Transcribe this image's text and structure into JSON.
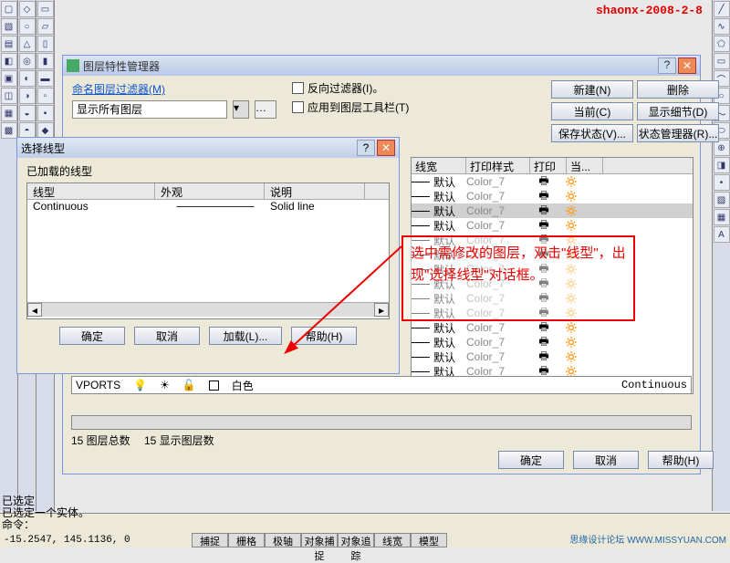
{
  "watermark": "shaonx-2008-2-8",
  "layerDialog": {
    "title": "图层特性管理器",
    "filterLabel": "命名图层过滤器(M)",
    "filterValue": "显示所有图层",
    "cbReverse": "反向过滤器(I)。",
    "cbApply": "应用到图层工具栏(T)",
    "buttons": {
      "new": "新建(N)",
      "delete": "删除",
      "current": "当前(C)",
      "details": "显示细节(D)",
      "saveState": "保存状态(V)...",
      "stateManager": "状态管理器(R)..."
    },
    "columns": {
      "lineweight": "线宽",
      "plotstyle": "打印样式",
      "print": "打印",
      "current": "当..."
    },
    "rows": [
      {
        "lw": "默认",
        "ps": "Color_7",
        "sel": false
      },
      {
        "lw": "默认",
        "ps": "Color_7",
        "sel": false
      },
      {
        "lw": "默认",
        "ps": "Color_7",
        "sel": true
      },
      {
        "lw": "默认",
        "ps": "Color_7",
        "sel": false
      },
      {
        "lw": "默认",
        "ps": "Color_7",
        "sel": false
      },
      {
        "lw": "默认",
        "ps": "Color_7",
        "sel": false
      },
      {
        "lw": "默认",
        "ps": "Color_7",
        "sel": false
      },
      {
        "lw": "默认",
        "ps": "Color_7",
        "sel": false
      },
      {
        "lw": "默认",
        "ps": "Color_7",
        "sel": false
      },
      {
        "lw": "默认",
        "ps": "Color_7",
        "sel": false
      },
      {
        "lw": "默认",
        "ps": "Color_7",
        "sel": false
      },
      {
        "lw": "默认",
        "ps": "Color_7",
        "sel": false
      },
      {
        "lw": "默认",
        "ps": "Color_7",
        "sel": false
      },
      {
        "lw": "默认",
        "ps": "Color_7",
        "sel": false
      }
    ],
    "fullRow": {
      "name": "VPORTS",
      "color": "白色",
      "linetype": "Continuous"
    },
    "status": {
      "total": "15 图层总数",
      "shown": "15 显示图层数"
    },
    "ok": "确定",
    "cancel": "取消",
    "help": "帮助(H)"
  },
  "linetypeDialog": {
    "title": "选择线型",
    "loaded": "已加载的线型",
    "col1": "线型",
    "col2": "外观",
    "col3": "说明",
    "row": {
      "name": "Continuous",
      "desc": "Solid line"
    },
    "ok": "确定",
    "cancel": "取消",
    "load": "加载(L)...",
    "help": "帮助(H)"
  },
  "annotation": "选中需修改的图层，双击\"线型\"，出现\"选择线型\"对话框。",
  "cmd": {
    "l1": "已选定",
    "l2": "已选定一个实体。",
    "l3": "命令："
  },
  "coords": "-15.2547, 145.1136, 0",
  "modes": [
    "捕捉",
    "栅格",
    "极轴",
    "对象捕捉",
    "对象追踪",
    "线宽",
    "模型"
  ],
  "footer": "思缘设计论坛 WWW.MISSYUAN.COM"
}
